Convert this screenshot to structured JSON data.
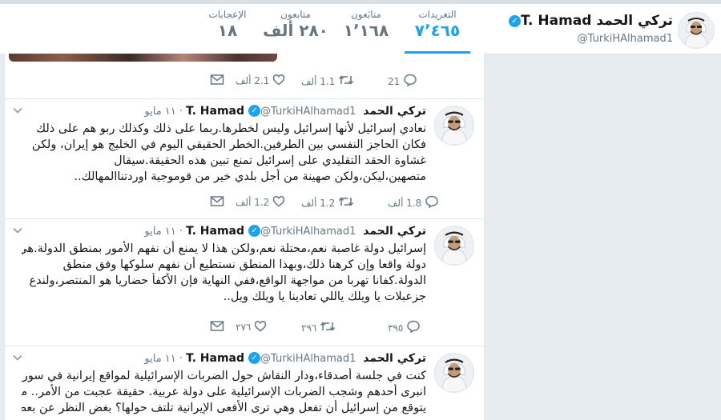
{
  "profile": {
    "name": "تركي الحمد T. Hamad",
    "handle": "@TurkiHAlhamad1"
  },
  "nav": [
    {
      "label": "التغريدات",
      "value": "٧٬٤٦٥",
      "active": true
    },
    {
      "label": "متابَعون",
      "value": "١٬١٦٨"
    },
    {
      "label": "متابعون",
      "value": "٢٨٠ ألف"
    },
    {
      "label": "الإعجابات",
      "value": "١٨"
    }
  ],
  "top_actions": {
    "reply": "21",
    "retweet": "1.1 ألف",
    "like": "2.1 ألف"
  },
  "tweets": [
    {
      "name": "تركي الحمد T. Hamad",
      "handle": "@TurkiHAlhamad1",
      "date": "١١ مايو",
      "lines": [
        "نعادي إسرائيل لأنها إسرائيل وليس لخطرها.ربما على ذلك وكذلك ربو هم على ذلك",
        "فكان الحاجز النفسي بين الطرفين.الخطر الحقيقي اليوم في الخليج هو إيران، ولكن",
        "غشاوة الحقد التقليدي على إسرائيل تمنع تبين هذه الحقيقة.سيقال",
        "متصهين،ليكن،ولكن صهينة من أجل بلدي خير من قوموجية اوردتناالمهالك.."
      ],
      "actions": {
        "reply": "1.8 ألف",
        "retweet": "1.2 ألف",
        "like": "1.2 ألف"
      }
    },
    {
      "name": "تركي الحمد T. Hamad",
      "handle": "@TurkiHAlhamad1",
      "date": "١١ مايو",
      "lines": [
        "إسرائيل دولة غاصبة نعم،محتلة نعم،ولكن هذا لا يمنع أن نفهم الأمور بمنطق الدولة.هي",
        "دولة واقعا وإن كرهنا ذلك،وبهذا المنطق نستطيع أن نفهم سلوكها وفق منطق",
        "الدولة.كفانا تهربا من مواجهة الواقع،ففي النهاية فإن الأكفأ حضاريا هو المنتصر،ولندع",
        "جزعبلات يا ويلك ياللي تعادينا يا ويلك ويل.."
      ],
      "actions": {
        "reply": "٣٩٥",
        "retweet": "٢٩٦",
        "like": "٢٧٦"
      }
    },
    {
      "name": "تركي الحمد T. Hamad",
      "handle": "@TurkiHAlhamad1",
      "date": "١١ مايو",
      "lines": [
        "كنت في جلسة أصدقاء،ودار النقاش حول الضربات الإسرائيلية لمواقع إيرانية في سوريا.",
        "انبرى أحدهم وشجب الضربات الإسرائيلية على دولة عربية. حقيقة عجبت من الأمر.. ماذا",
        "يتوقع من إسرائيل أن تفعل وهي ترى الأفعى الإيرانية تلتف حولها؟ بغض النظر عن بعض"
      ]
    }
  ],
  "colors": {
    "accent": "#1da1f2",
    "text": "#14171a",
    "muted": "#657786",
    "border": "#e1e8ed",
    "background": "#e6ecf0"
  },
  "icons": [
    "verified-badge-icon",
    "reply-icon",
    "retweet-icon",
    "like-icon",
    "direct-message-icon",
    "chevron-down-icon"
  ]
}
